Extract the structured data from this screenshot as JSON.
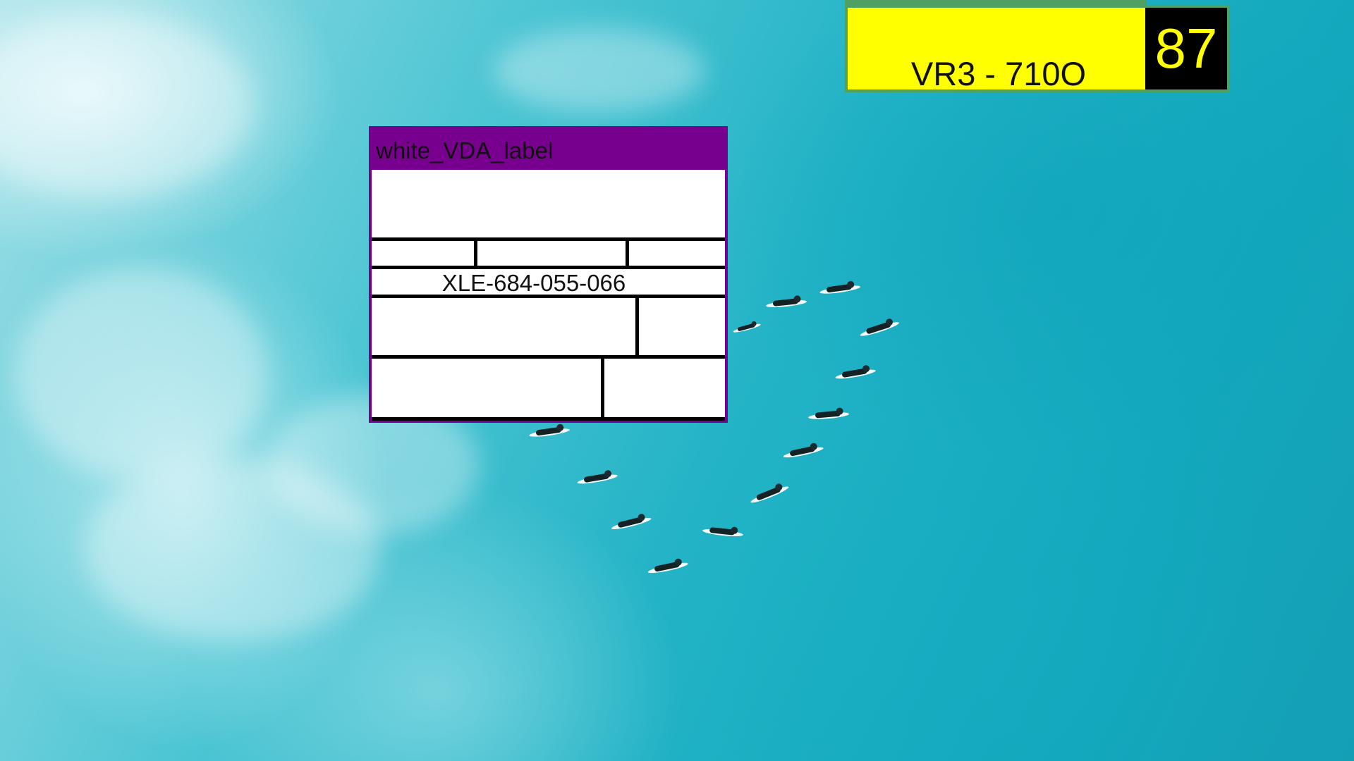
{
  "background": {
    "scene": "aerial ocean with surfers",
    "water_color": "#1fb0c4"
  },
  "vda_label": {
    "title": "white_VDA_label",
    "code": "XLE-684-055-066",
    "border_color": "#78008f"
  },
  "plate_label": {
    "text": "VR3 - 710O",
    "number": "87",
    "background_color": "#ffff00",
    "border_color": "#4ea163"
  }
}
